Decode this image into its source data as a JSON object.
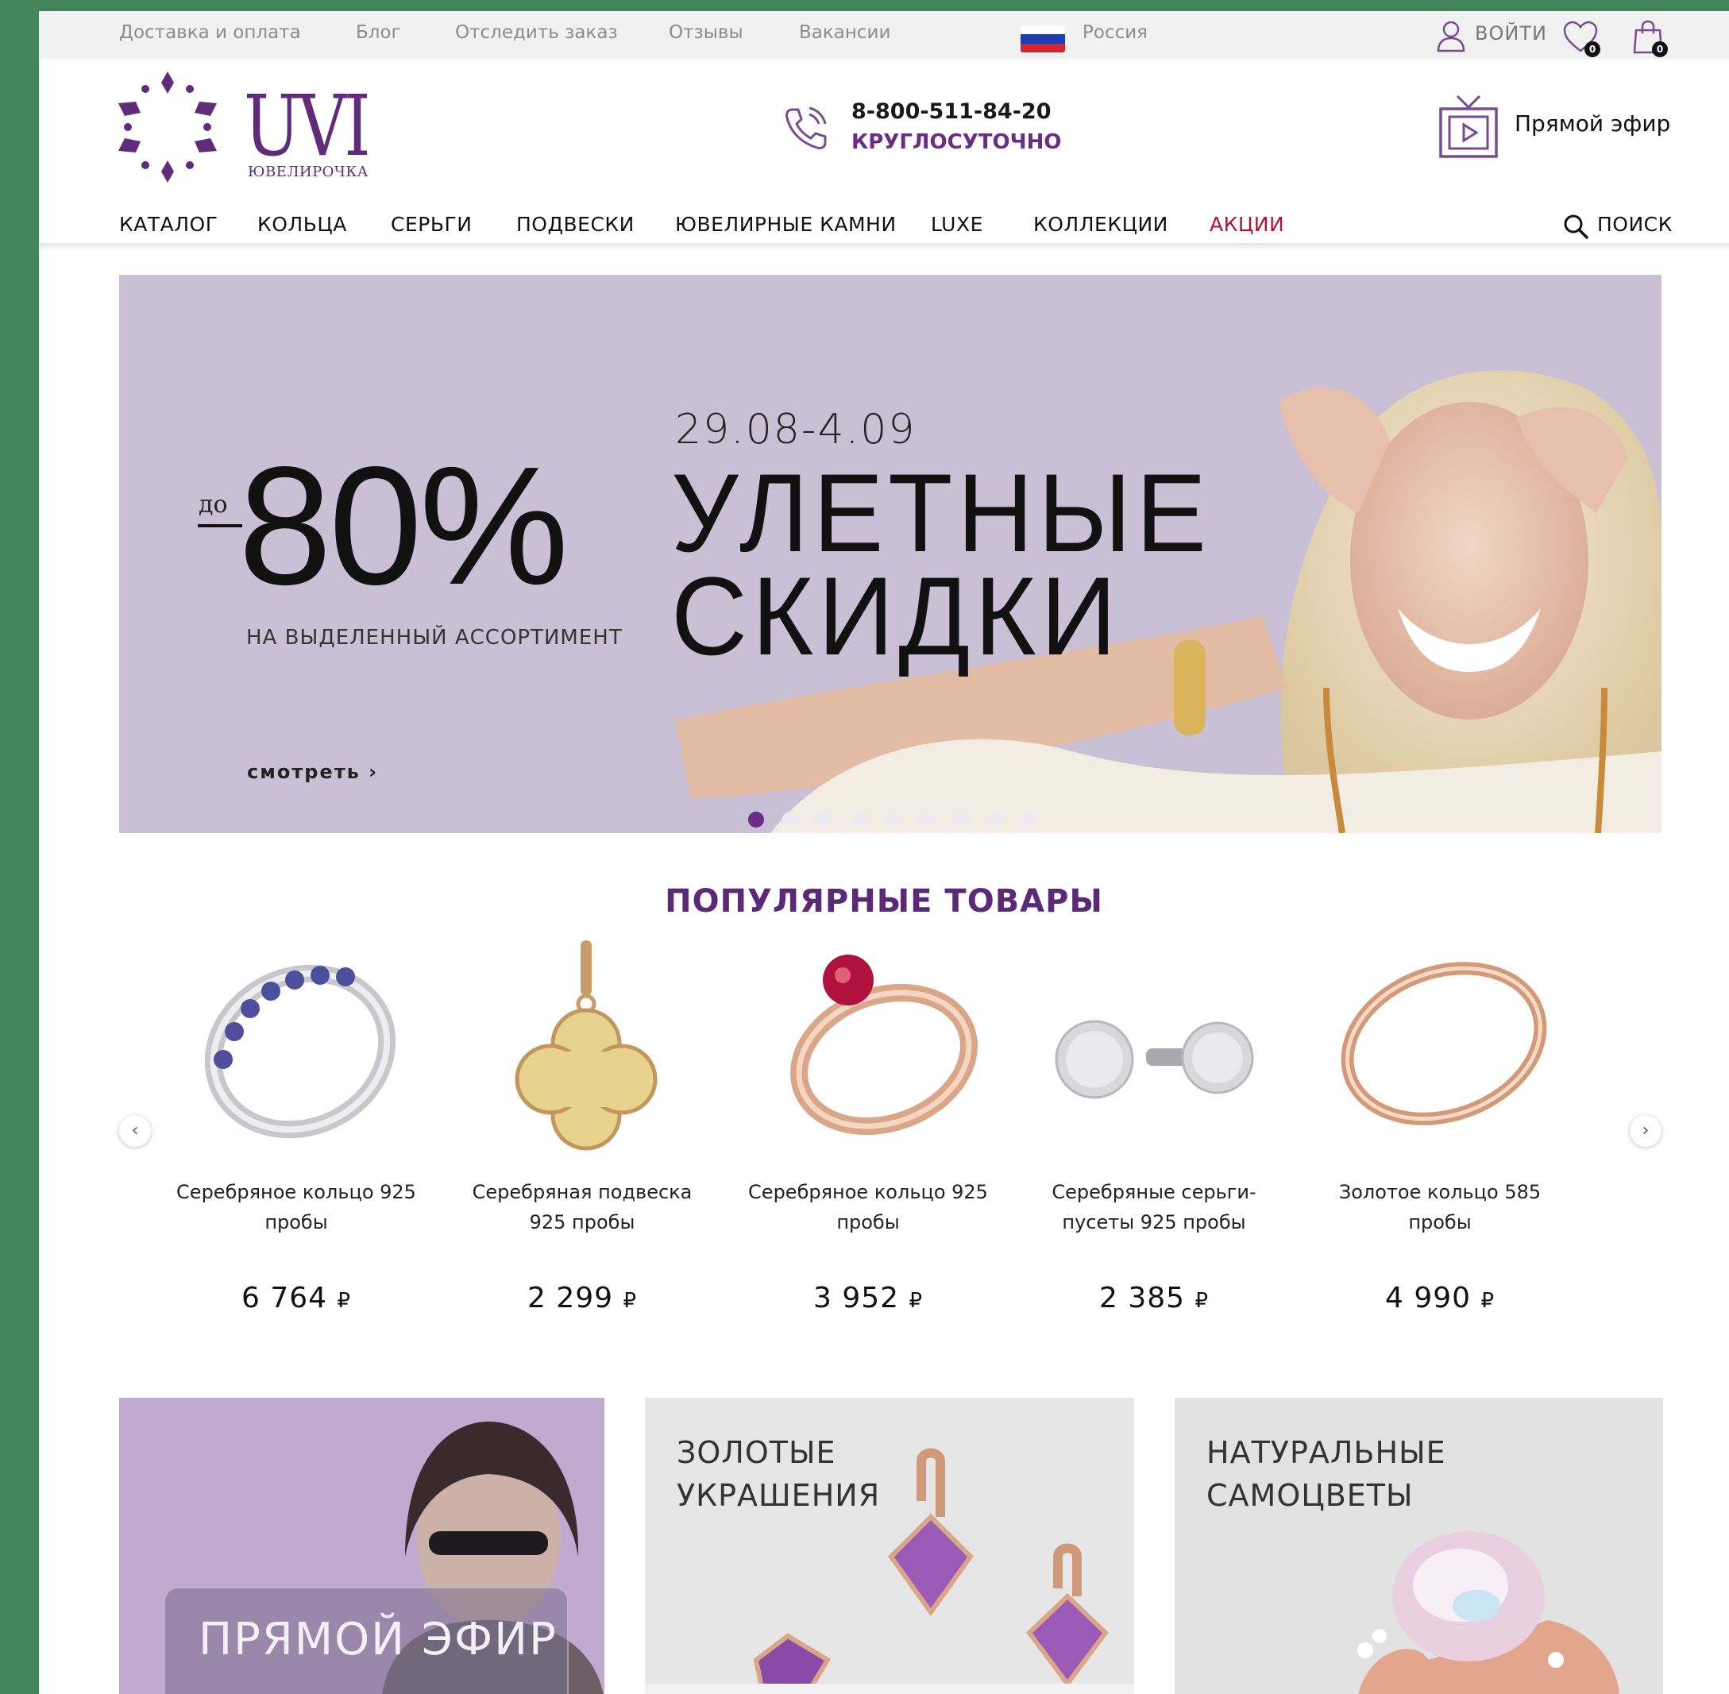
{
  "topbar": {
    "links": [
      "Доставка и оплата",
      "Блог",
      "Отследить заказ",
      "Отзывы",
      "Вакансии"
    ],
    "region": "Россия",
    "login": "ВОЙТИ",
    "wishlist_count": "0",
    "cart_count": "0"
  },
  "header": {
    "logo_text": "UVI",
    "logo_sub": "ЮВЕЛИРОЧКА",
    "phone": "8-800-511-84-20",
    "phone_note": "КРУГЛОСУТОЧНО",
    "live_label": "Прямой эфир"
  },
  "nav": {
    "items": [
      "КАТАЛОГ",
      "КОЛЬЦА",
      "СЕРЬГИ",
      "ПОДВЕСКИ",
      "ЮВЕЛИРНЫЕ КАМНИ",
      "LUXE",
      "КОЛЛЕКЦИИ",
      "АКЦИИ"
    ],
    "search": "ПОИСК"
  },
  "hero": {
    "date": "29.08-4.09",
    "title_line1": "УЛЕТНЫЕ",
    "title_line2": "СКИДКИ",
    "prefix": "до",
    "discount": "80%",
    "subtitle": "НА ВЫДЕЛЕННЫЙ АССОРТИМЕНТ",
    "cta": "смотреть ›",
    "slides_total": 9,
    "active_slide": 1
  },
  "popular": {
    "title": "ПОПУЛЯРНЫЕ ТОВАРЫ",
    "products": [
      {
        "name": "Серебряное кольцо 925 пробы",
        "price": "6 764",
        "currency": "₽"
      },
      {
        "name": "Серебряная подвеска 925 пробы",
        "price": "2 299",
        "currency": "₽"
      },
      {
        "name": "Серебряное кольцо 925 пробы",
        "price": "3 952",
        "currency": "₽"
      },
      {
        "name": "Серебряные серьги-пусеты 925 пробы",
        "price": "2 385",
        "currency": "₽"
      },
      {
        "name": "Золотое кольцо 585 пробы",
        "price": "4 990",
        "currency": "₽"
      }
    ]
  },
  "categories": [
    {
      "label": "ПРЯМОЙ ЭФИР"
    },
    {
      "label": "ЗОЛОТЫЕ\nУКРАШЕНИЯ"
    },
    {
      "label": "НАТУРАЛЬНЫЕ\nСАМОЦВЕТЫ"
    }
  ],
  "colors": {
    "brand": "#5f2c7a",
    "sale": "#b4122e",
    "hero_bg": "#c9c0d6"
  }
}
